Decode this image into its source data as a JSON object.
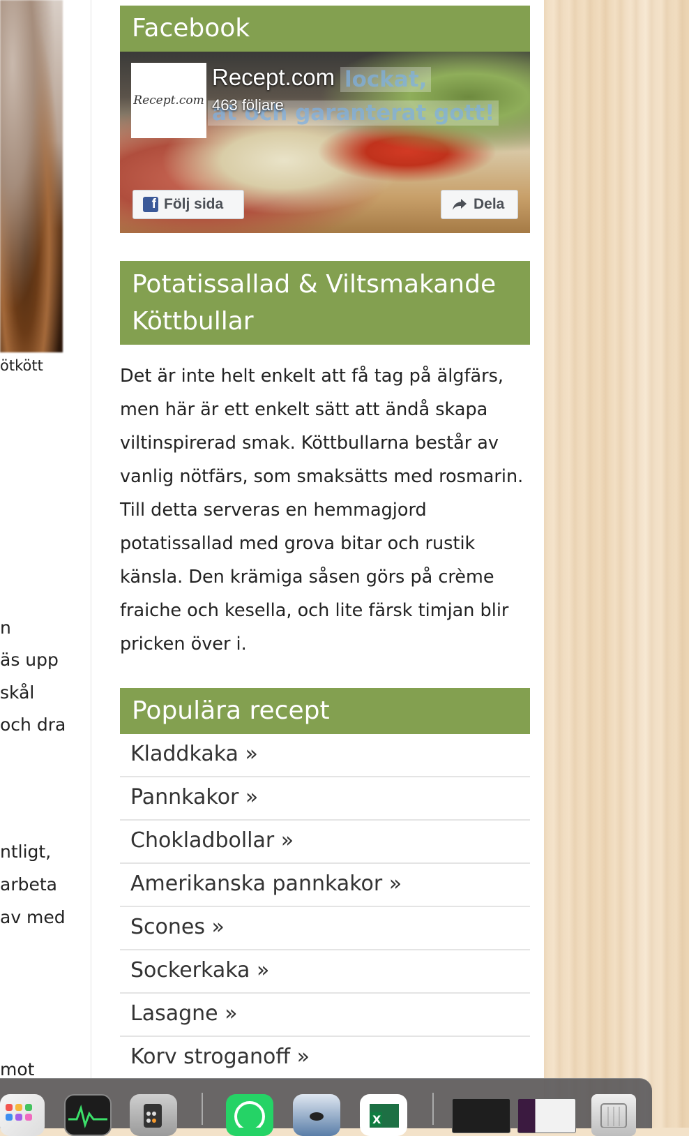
{
  "left_column": {
    "lines": [
      "ötkött",
      "n",
      "äs upp",
      "skål",
      "och dra",
      "ntligt,",
      "arbeta",
      "av med",
      "mot"
    ]
  },
  "facebook_widget": {
    "title": "Facebook",
    "page_name": "Recept.com",
    "followers": "463 följare",
    "logo_text": "Recept.com",
    "overlay_text_1": "lockat,",
    "overlay_text_2": "at och garanterat gott!",
    "follow_button": "Följ sida",
    "share_button": "Dela"
  },
  "featured": {
    "title": "Potatissallad & Viltsmakande Köttbullar",
    "description": "Det är inte helt enkelt att få tag på älgfärs, men här är ett enkelt sätt att ändå skapa viltinspirerad smak. Köttbullarna består av vanlig nötfärs, som smaksätts med rosmarin. Till detta serveras en hemmagjord potatissallad med grova bitar och rustik känsla. Den krämiga såsen görs på crème fraiche och kesella, och lite färsk timjan blir pricken över i."
  },
  "popular": {
    "title": "Populära recept",
    "items": [
      "Kladdkaka »",
      "Pannkakor »",
      "Chokladbollar »",
      "Amerikanska pannkakor »",
      "Scones »",
      "Sockerkaka »",
      "Lasagne »",
      "Korv stroganoff »"
    ]
  },
  "dock": {
    "apps": [
      "launchpad-icon",
      "activity-monitor-icon",
      "calculator-icon",
      "whatsapp-icon",
      "finder-disk-icon",
      "excel-icon",
      "window-thumb-1",
      "window-thumb-2",
      "trash-icon"
    ]
  },
  "colors": {
    "accent": "#83a050"
  }
}
